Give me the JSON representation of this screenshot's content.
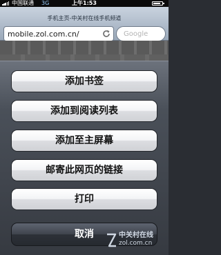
{
  "status_bar": {
    "carrier": "中国联通",
    "network": "3G",
    "time": "上午1:53"
  },
  "browser": {
    "page_title": "手机主页-中关村在线手机频道",
    "url": "mobile.zol.com.cn/",
    "search_placeholder": "Google"
  },
  "action_sheet": {
    "items": [
      {
        "label": "添加书签"
      },
      {
        "label": "添加到阅读列表"
      },
      {
        "label": "添加至主屏幕"
      },
      {
        "label": "邮寄此网页的链接"
      },
      {
        "label": "打印"
      }
    ],
    "cancel_label": "取消"
  },
  "watermark": {
    "cn": "中关村在线",
    "en": "zol.com.cn"
  },
  "colors": {
    "sheet_top": "#6c727c",
    "sheet_bottom": "#363a41",
    "button_light": "#ffffff",
    "button_dark": "#d0d2d6",
    "cancel_dark": "#262a30"
  },
  "icons": [
    "signal-icon",
    "battery-icon",
    "reload-icon",
    "zol-logo-icon"
  ]
}
